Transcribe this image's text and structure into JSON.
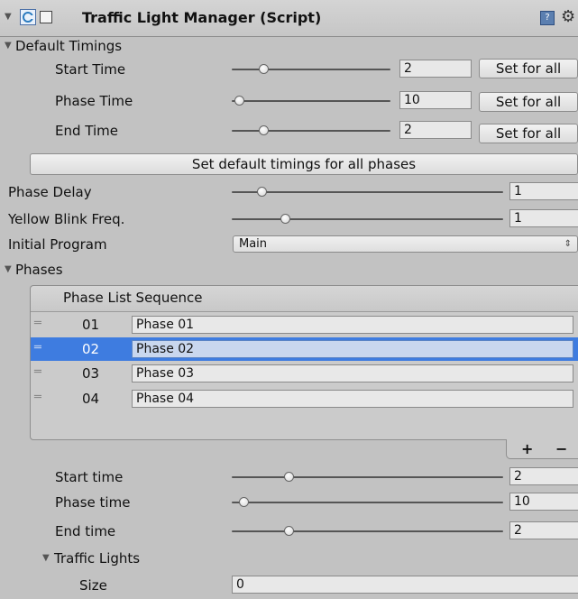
{
  "header": {
    "title": "Traffic Light Manager (Script)",
    "script_icon": "csharp-script-icon",
    "help_icon": "help-book-icon",
    "gear_icon": "gear-icon"
  },
  "default_timings": {
    "label": "Default Timings",
    "rows": [
      {
        "label": "Start Time",
        "value": "2",
        "button": "Set for all",
        "slider_fraction": 0.2
      },
      {
        "label": "Phase Time",
        "value": "10",
        "button": "Set for all",
        "slider_fraction": 0.0
      },
      {
        "label": "End Time",
        "value": "2",
        "button": "Set for all",
        "slider_fraction": 0.2
      }
    ],
    "set_all_button": "Set default timings for all phases"
  },
  "phase_delay": {
    "label": "Phase Delay",
    "value": "1",
    "slider_fraction": 0.1
  },
  "yellow_blink": {
    "label": "Yellow Blink Freq.",
    "value": "1",
    "slider_fraction": 0.2
  },
  "initial_program": {
    "label": "Initial Program",
    "value": "Main",
    "arrow": "⇕"
  },
  "phases": {
    "label": "Phases",
    "list_header": "Phase List Sequence",
    "handle": "═",
    "items": [
      {
        "index": "01",
        "name": "Phase 01",
        "selected": false
      },
      {
        "index": "02",
        "name": "Phase 02",
        "selected": true
      },
      {
        "index": "03",
        "name": "Phase 03",
        "selected": false
      },
      {
        "index": "04",
        "name": "Phase 04",
        "selected": false
      }
    ],
    "add_label": "+",
    "remove_label": "−"
  },
  "phase_timings": {
    "rows": [
      {
        "label": "Start time",
        "value": "2",
        "slider_fraction": 0.2
      },
      {
        "label": "Phase time",
        "value": "10",
        "slider_fraction": 0.0
      },
      {
        "label": "End time",
        "value": "2",
        "slider_fraction": 0.2
      }
    ]
  },
  "traffic_lights": {
    "label": "Traffic Lights",
    "size_label": "Size",
    "size_value": "0"
  },
  "colors": {
    "background": "#c2c2c2",
    "selection": "#3e7ce0",
    "selected_field": "#c9d7ee"
  }
}
